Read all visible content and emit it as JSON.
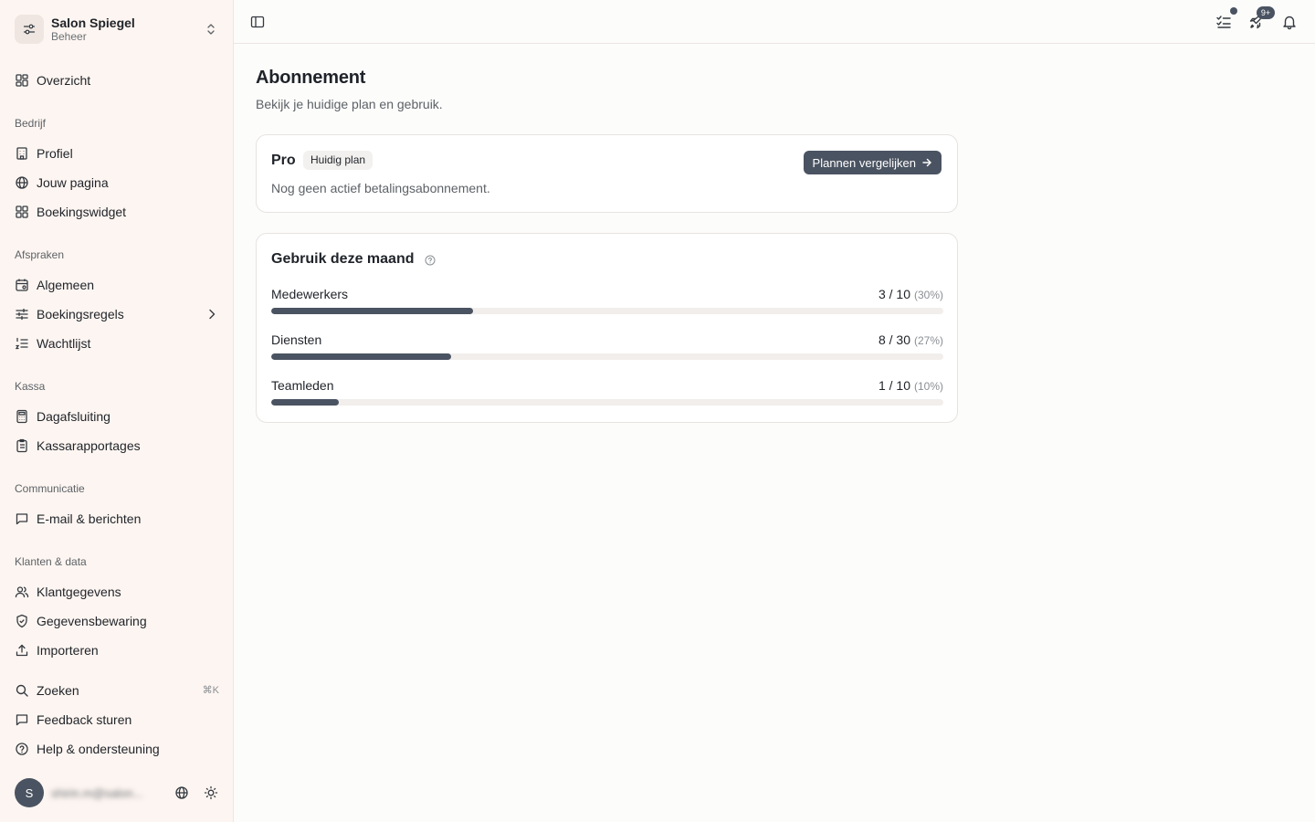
{
  "org": {
    "name": "Salon Spiegel",
    "role": "Beheer"
  },
  "nav": {
    "overview": "Overzicht",
    "sections": {
      "company": "Bedrijf",
      "appointments": "Afspraken",
      "register": "Kassa",
      "communication": "Communicatie",
      "customers": "Klanten & data"
    },
    "items": {
      "profile": "Profiel",
      "your_page": "Jouw pagina",
      "booking_widget": "Boekingswidget",
      "general": "Algemeen",
      "booking_rules": "Boekingsregels",
      "waitlist": "Wachtlijst",
      "day_close": "Dagafsluiting",
      "register_reports": "Kassarapportages",
      "email_messages": "E-mail & berichten",
      "customer_data": "Klantgegevens",
      "data_retention": "Gegevensbewaring",
      "import": "Importeren"
    },
    "footer": {
      "search": "Zoeken",
      "search_shortcut": "⌘K",
      "feedback": "Feedback sturen",
      "help": "Help & ondersteuning"
    }
  },
  "user": {
    "initial": "S",
    "email": "shirin.m@salon..."
  },
  "topbar": {
    "updates_count": "9+"
  },
  "page": {
    "title": "Abonnement",
    "subtitle": "Bekijk je huidige plan en gebruik."
  },
  "plan": {
    "name": "Pro",
    "badge": "Huidig plan",
    "description": "Nog geen actief betalingsabonnement.",
    "compare_button": "Plannen vergelijken"
  },
  "usage": {
    "title": "Gebruik deze maand",
    "rows": [
      {
        "label": "Medewerkers",
        "value": "3 / 10",
        "pct": "(30%)",
        "fraction": 0.3
      },
      {
        "label": "Diensten",
        "value": "8 / 30",
        "pct": "(27%)",
        "fraction": 0.267
      },
      {
        "label": "Teamleden",
        "value": "1 / 10",
        "pct": "(10%)",
        "fraction": 0.1
      }
    ]
  },
  "colors": {
    "sidebar_bg": "#fdf5f1",
    "accent": "#4a5361",
    "track": "#f1eeec"
  }
}
